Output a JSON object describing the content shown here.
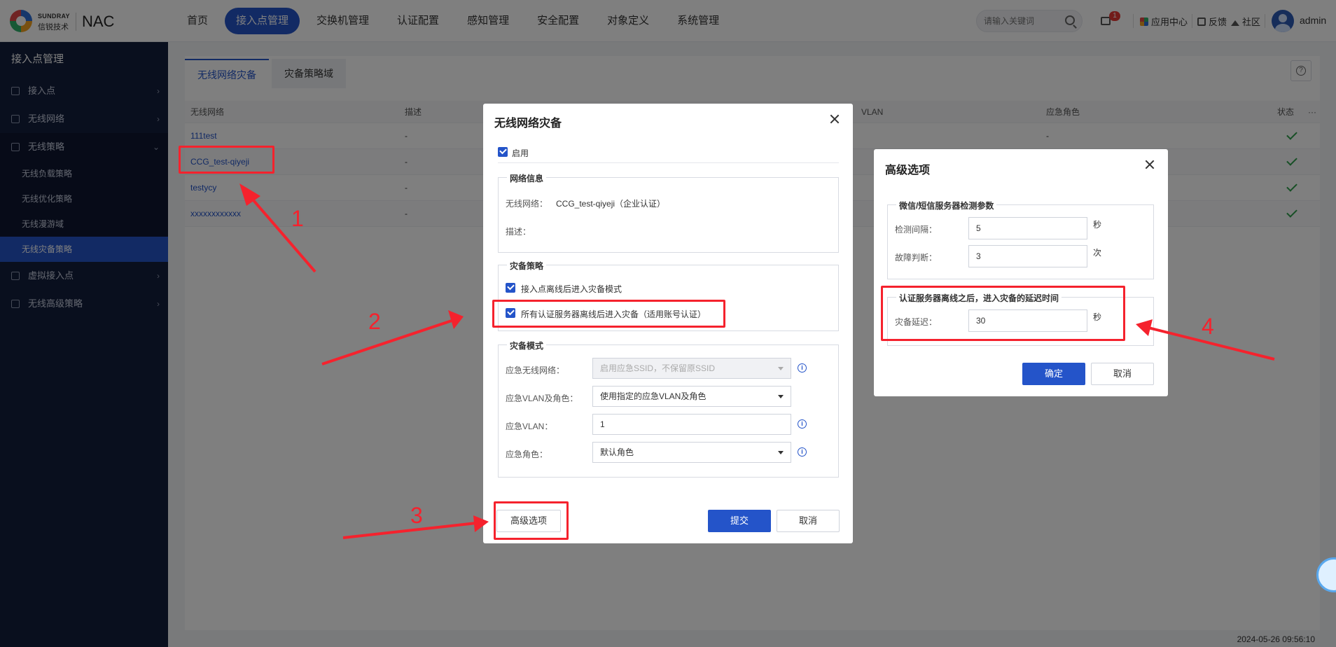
{
  "brand": {
    "en": "SUNDRAY",
    "cn": "信锐技术",
    "product": "NAC"
  },
  "nav": [
    "首页",
    "接入点管理",
    "交换机管理",
    "认证配置",
    "感知管理",
    "安全配置",
    "对象定义",
    "系统管理"
  ],
  "search": {
    "placeholder": "请输入关键词"
  },
  "notifications": {
    "count": "1"
  },
  "toolbar": {
    "app_center": "应用中心",
    "feedback": "反馈",
    "community": "社区",
    "user": "admin"
  },
  "sidebar": {
    "title": "接入点管理",
    "items": [
      "接入点",
      "无线网络",
      "无线策略"
    ],
    "subitems": [
      "无线负载策略",
      "无线优化策略",
      "无线漫游域",
      "无线灾备策略"
    ],
    "items_after": [
      "虚拟接入点",
      "无线高级策略"
    ]
  },
  "tabs": [
    "无线网络灾备",
    "灾备策略域"
  ],
  "table": {
    "headers": [
      "无线网络",
      "描述",
      "VLAN",
      "应急角色",
      "状态",
      "···"
    ],
    "rows": [
      {
        "name": "111test",
        "desc": "-",
        "role": "-"
      },
      {
        "name": "CCG_test-qiyeji",
        "desc": "-",
        "role": ""
      },
      {
        "name": "testycy",
        "desc": "-",
        "role": ""
      },
      {
        "name": "xxxxxxxxxxxx",
        "desc": "-",
        "role": ""
      }
    ]
  },
  "timestamp": "2024-05-26 09:56:10",
  "dialog_main": {
    "title": "无线网络灾备",
    "enable_label": "启用",
    "network_info": {
      "legend": "网络信息",
      "network_label": "无线网络：",
      "network_value": "CCG_test-qiyeji（企业认证）",
      "desc_label": "描述："
    },
    "policy": {
      "legend": "灾备策略",
      "option1": "接入点离线后进入灾备模式",
      "option2": "所有认证服务器离线后进入灾备（适用账号认证）"
    },
    "mode": {
      "legend": "灾备模式",
      "emergency_wlan_label": "应急无线网络：",
      "emergency_wlan_value": "启用应急SSID，不保留原SSID",
      "vlan_role_label": "应急VLAN及角色：",
      "vlan_role_value": "使用指定的应急VLAN及角色",
      "vlan_label": "应急VLAN：",
      "vlan_value": "1",
      "role_label": "应急角色：",
      "role_value": "默认角色"
    },
    "advanced_button": "高级选项",
    "submit_button": "提交",
    "cancel_button": "取消"
  },
  "dialog_adv": {
    "title": "高级选项",
    "group1": {
      "legend": "微信/短信服务器检测参数",
      "interval_label": "检测间隔：",
      "interval_value": "5",
      "interval_unit": "秒",
      "fault_label": "故障判断：",
      "fault_value": "3",
      "fault_unit": "次"
    },
    "group2": {
      "legend": "认证服务器离线之后，进入灾备的延迟时间",
      "delay_label": "灾备延迟：",
      "delay_value": "30",
      "delay_unit": "秒"
    },
    "ok_button": "确定",
    "cancel_button": "取消"
  },
  "annotations": [
    "1",
    "2",
    "3",
    "4"
  ],
  "colors": {
    "primary": "#2454c9",
    "sidebar": "#131e3c",
    "annotation": "#f5222d",
    "success": "#2e9e4a"
  }
}
